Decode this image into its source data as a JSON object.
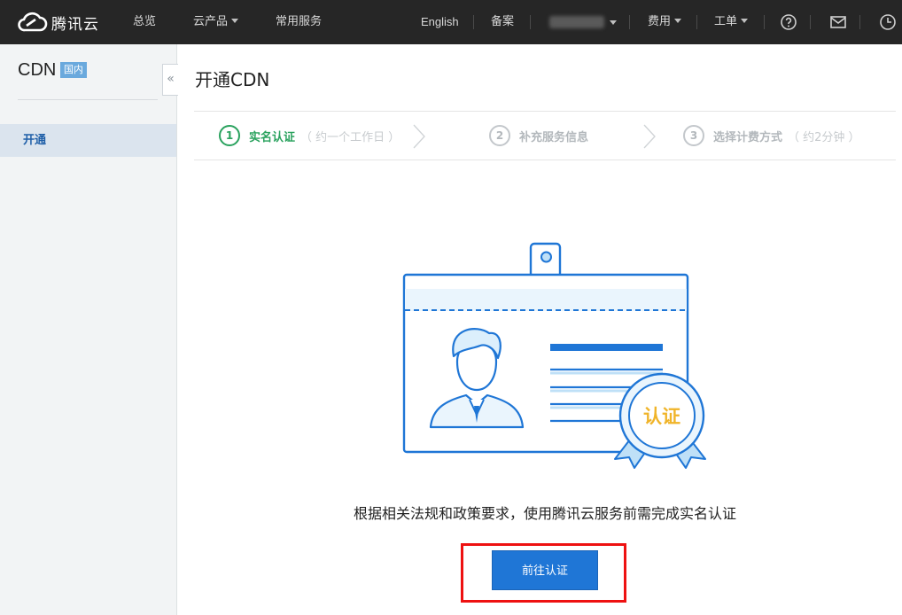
{
  "topbar": {
    "brand": "腾讯云",
    "nav": {
      "overview": "总览",
      "products": "云产品",
      "services": "常用服务"
    },
    "right": {
      "english": "English",
      "filing": "备案",
      "fees": "费用",
      "ticket": "工单"
    }
  },
  "sidebar": {
    "title": "CDN",
    "region_badge": "国内",
    "collapse_glyph": "«",
    "items": [
      {
        "label": "开通"
      }
    ]
  },
  "main": {
    "title": "开通CDN",
    "steps": [
      {
        "number": "1",
        "label": "实名认证",
        "hint": "（ 约一个工作日 ）",
        "active": true
      },
      {
        "number": "2",
        "label": "补充服务信息",
        "hint": "",
        "active": false
      },
      {
        "number": "3",
        "label": "选择计费方式",
        "hint": "（ 约2分钟 ）",
        "active": false
      }
    ],
    "illustration": {
      "seal_text": "认证"
    },
    "description": "根据相关法规和政策要求，使用腾讯云服务前需完成实名认证",
    "go_button": "前往认证"
  },
  "colors": {
    "topbar": "#262626",
    "accent_blue": "#1f76d6",
    "step_active": "#2aa25e",
    "seal": "#f0b429",
    "highlight_box": "#ee1111"
  }
}
